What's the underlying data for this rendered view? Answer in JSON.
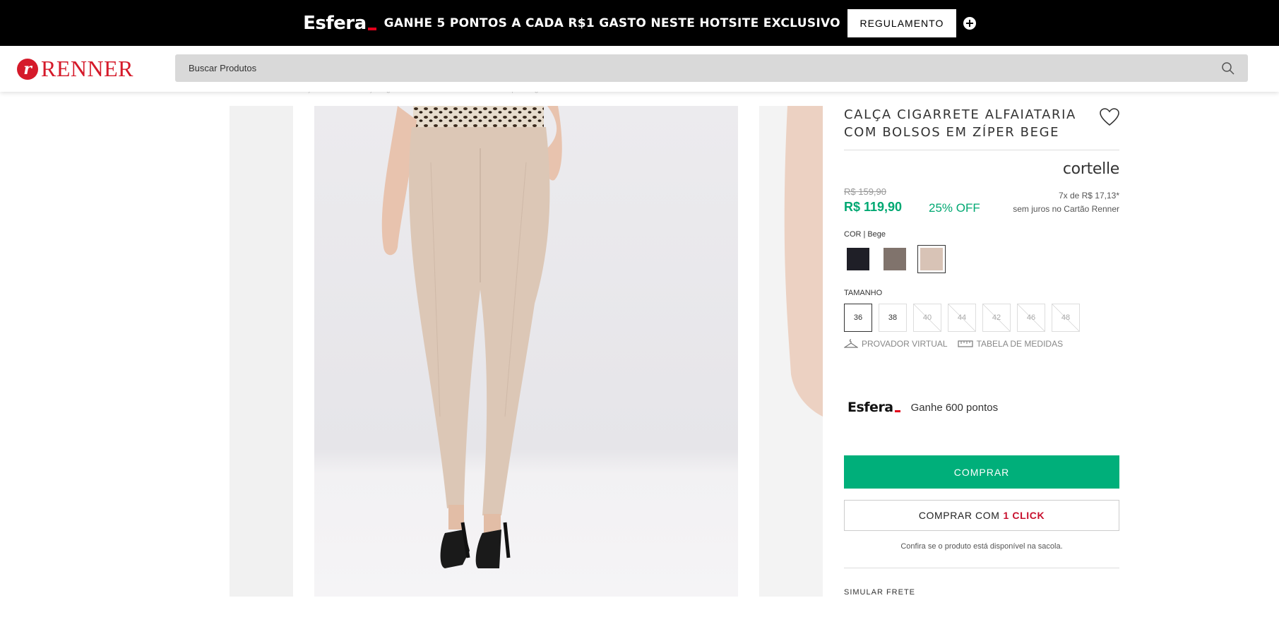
{
  "promo": {
    "logo": "Esfera",
    "text": "GANHE 5 PONTOS A CADA R$1 GASTO NESTE HOTSITE EXCLUSIVO",
    "button": "REGULAMENTO"
  },
  "header": {
    "logo_mark": "r",
    "logo_text": "RENNER",
    "search_placeholder": "Buscar Produtos"
  },
  "breadcrumb": "Home  /  Feminino  /  Calças  /  Cintura  /  Calça Cigarrete Alfaiataria com Bolsos em Zíper Bege",
  "product": {
    "title": "CALÇA CIGARRETE ALFAIATARIA COM BOLSOS EM ZÍPER BEGE",
    "brand": "cortelle",
    "old_price": "R$ 159,90",
    "price": "R$ 119,90",
    "discount": "25% OFF",
    "installments": "7x de R$ 17,13*",
    "installments_note": "sem juros no Cartão Renner",
    "color_label": "COR",
    "color_selected": "Bege",
    "colors": [
      {
        "name": "Preto",
        "hex": "#1f1f27"
      },
      {
        "name": "Marrom",
        "hex": "#80736c"
      },
      {
        "name": "Bege",
        "hex": "#d8c3b6"
      }
    ],
    "size_label": "TAMANHO",
    "sizes": [
      {
        "label": "36",
        "available": true,
        "selected": true
      },
      {
        "label": "38",
        "available": true,
        "selected": false
      },
      {
        "label": "40",
        "available": false,
        "selected": false
      },
      {
        "label": "44",
        "available": false,
        "selected": false
      },
      {
        "label": "42",
        "available": false,
        "selected": false
      },
      {
        "label": "46",
        "available": false,
        "selected": false
      },
      {
        "label": "48",
        "available": false,
        "selected": false
      }
    ],
    "provador": "PROVADOR VIRTUAL",
    "tabela": "TABELA DE MEDIDAS",
    "esfera_logo": "Esfera",
    "esfera_points": "Ganhe 600 pontos",
    "buy": "COMPRAR",
    "oneclick_prefix": "COMPRAR COM",
    "oneclick_highlight": "1 CLICK",
    "note": "Confira se o produto está disponível na sacola.",
    "frete": "SIMULAR FRETE"
  },
  "colors": {
    "accent_green": "#00af7a",
    "brand_red": "#d51a2a"
  }
}
